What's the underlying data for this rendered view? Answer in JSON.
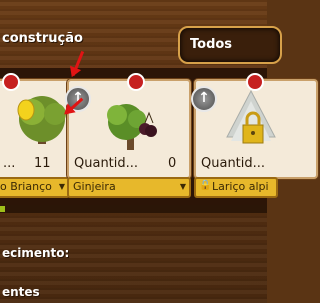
{
  "header": {
    "title": "construção",
    "filter_label": "Todos"
  },
  "cards": [
    {
      "name": "o Brianço",
      "count": "11"
    },
    {
      "name": "Ginjeira",
      "count_label": "Quantid...",
      "count": "0"
    },
    {
      "name": "Lariço alpi",
      "count_label": "Quantid..."
    }
  ],
  "progress": {
    "value": 0.02
  },
  "footer": {
    "label1": "ecimento:",
    "label2": "entes"
  },
  "colors": {
    "accent": "#e7b82b",
    "wood": "#5a3414",
    "arrow": "#e01414",
    "progress": "#9fbf1a"
  }
}
